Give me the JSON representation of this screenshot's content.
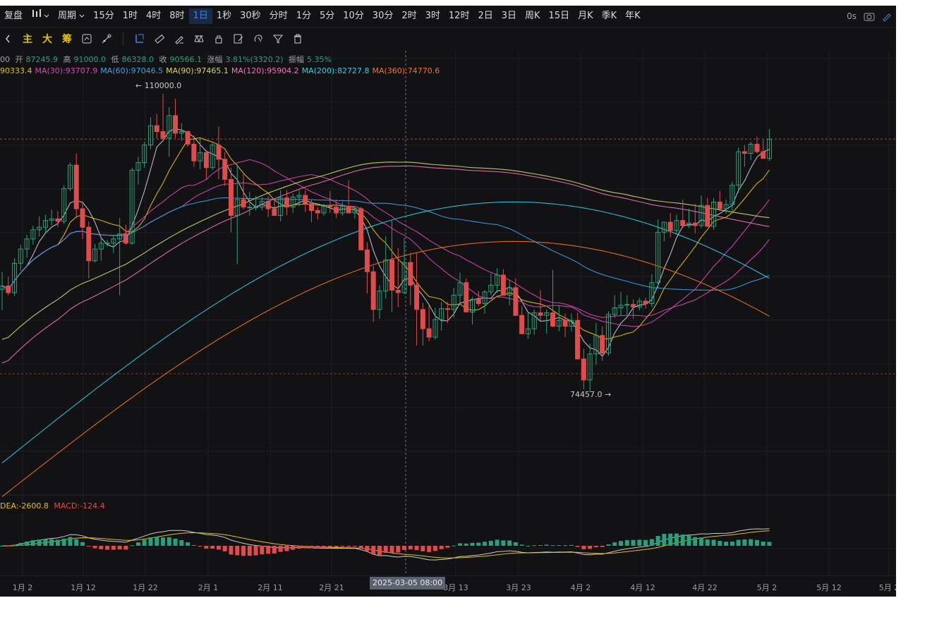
{
  "toolbar": {
    "items": [
      {
        "label": "复盘",
        "icon": "replay-icon"
      },
      {
        "label": "",
        "icon": "candle-type-icon"
      },
      {
        "label": "周期",
        "icon": "chevron-down-icon"
      },
      {
        "label": "15分"
      },
      {
        "label": "1时"
      },
      {
        "label": "4时"
      },
      {
        "label": "8时"
      },
      {
        "label": "1日",
        "active": true
      },
      {
        "label": "1秒"
      },
      {
        "label": "30秒"
      },
      {
        "label": "分时"
      },
      {
        "label": "1分"
      },
      {
        "label": "5分"
      },
      {
        "label": "10分"
      },
      {
        "label": "30分"
      },
      {
        "label": "2时"
      },
      {
        "label": "3时"
      },
      {
        "label": "12时"
      },
      {
        "label": "2日"
      },
      {
        "label": "3日"
      },
      {
        "label": "周K"
      },
      {
        "label": "15日"
      },
      {
        "label": "月K"
      },
      {
        "label": "季K"
      },
      {
        "label": "年K"
      }
    ],
    "right": {
      "time_label": "0s"
    }
  },
  "tools": {
    "text_items": [
      "主",
      "大",
      "筹"
    ]
  },
  "ohlc": {
    "prefix": "00",
    "open_label": "开",
    "open": "87245.9",
    "high_label": "高",
    "high": "91000.0",
    "low_label": "低",
    "low": "86328.0",
    "close_label": "收",
    "close": "90566.1",
    "change_label": "涨幅",
    "change": "3.81%(3320.2)",
    "amplitude_label": "振幅",
    "amplitude": "5.35%"
  },
  "ma_legend": [
    {
      "text": "90333.4",
      "color": "#e5c100"
    },
    {
      "text": "MA(30):93707.9",
      "color": "#d946b8"
    },
    {
      "text": "MA(60):97046.5",
      "color": "#3aa0e8"
    },
    {
      "text": "MA(90):97465.1",
      "color": "#d4d66a"
    },
    {
      "text": "MA(120):95904.2",
      "color": "#f472b6"
    },
    {
      "text": "MA(200):82727.8",
      "color": "#22d3ee"
    },
    {
      "text": "MA(360):74770.6",
      "color": "#f97316"
    }
  ],
  "price_marks": {
    "high": "← 110000.0",
    "low": "74457.0 →"
  },
  "macd_legend": {
    "dea": "DEA:-2600.8",
    "macd": "MACD:-124.4"
  },
  "x_axis": {
    "labels": [
      "1月 2",
      "1月 12",
      "1月 22",
      "2月 1",
      "2月 11",
      "2月 21",
      "3月 13",
      "3月 23",
      "4月 2",
      "4月 12",
      "4月 22",
      "5月 2",
      "5月 12",
      "5月 2"
    ],
    "crosshair_label": "2025-03-05 08:00"
  },
  "colors": {
    "up": "#26a17b",
    "down": "#e04b4b",
    "background": "#121214"
  },
  "chart_data": {
    "type": "candlestick",
    "ohlc": [
      [
        86700,
        88800,
        84200,
        87100
      ],
      [
        87100,
        88200,
        86000,
        86300
      ],
      [
        86300,
        90400,
        85900,
        89800
      ],
      [
        89800,
        92000,
        88900,
        91500
      ],
      [
        91500,
        93200,
        90500,
        92700
      ],
      [
        92700,
        94300,
        92000,
        93800
      ],
      [
        93800,
        95400,
        93000,
        94100
      ],
      [
        94100,
        95600,
        93400,
        94900
      ],
      [
        94900,
        96200,
        94300,
        95100
      ],
      [
        95100,
        96000,
        94100,
        94800
      ],
      [
        94800,
        99100,
        94500,
        98700
      ],
      [
        98700,
        101800,
        98400,
        101500
      ],
      [
        101500,
        102900,
        95200,
        96300
      ],
      [
        96300,
        97200,
        92700,
        94100
      ],
      [
        94100,
        94800,
        88000,
        90100
      ],
      [
        90100,
        92100,
        89900,
        91500
      ],
      [
        91500,
        92800,
        90100,
        92200
      ],
      [
        92200,
        92600,
        91800,
        92200
      ],
      [
        92200,
        93100,
        91000,
        92700
      ],
      [
        92700,
        95200,
        86000,
        93300
      ],
      [
        93300,
        94400,
        92000,
        92200
      ],
      [
        92200,
        101200,
        92000,
        100900
      ],
      [
        100900,
        102500,
        99200,
        101800
      ],
      [
        101800,
        104300,
        101200,
        103900
      ],
      [
        103900,
        107200,
        103400,
        106200
      ],
      [
        106200,
        107600,
        104700,
        105500
      ],
      [
        105500,
        110000,
        104800,
        104700
      ],
      [
        104700,
        108400,
        102500,
        107400
      ],
      [
        107400,
        109400,
        104700,
        105300
      ],
      [
        105300,
        106500,
        104400,
        105500
      ],
      [
        105500,
        105600,
        103700,
        104000
      ],
      [
        104000,
        105000,
        101300,
        102000
      ],
      [
        102000,
        104600,
        101000,
        103000
      ],
      [
        103000,
        103300,
        99800,
        101200
      ],
      [
        101200,
        104300,
        100900,
        103900
      ],
      [
        103900,
        106100,
        99800,
        102200
      ],
      [
        102200,
        103100,
        99000,
        99800
      ],
      [
        99800,
        101200,
        93500,
        95500
      ],
      [
        95500,
        101600,
        89700,
        97400
      ],
      [
        97400,
        100400,
        96200,
        96500
      ],
      [
        96500,
        98300,
        95500,
        96500
      ],
      [
        96500,
        97800,
        96100,
        96500
      ],
      [
        96500,
        97700,
        96100,
        97200
      ],
      [
        97200,
        97800,
        95300,
        96300
      ],
      [
        96300,
        97600,
        95900,
        95500
      ],
      [
        95500,
        98500,
        94800,
        97600
      ],
      [
        97600,
        98500,
        95500,
        96500
      ],
      [
        96500,
        98100,
        95800,
        97700
      ],
      [
        97700,
        98500,
        96600,
        97900
      ],
      [
        97900,
        98500,
        95900,
        96900
      ],
      [
        96900,
        97300,
        94700,
        96100
      ],
      [
        96100,
        96500,
        95000,
        95800
      ],
      [
        95800,
        96900,
        95500,
        96600
      ],
      [
        96600,
        98400,
        95800,
        96500
      ],
      [
        96500,
        97400,
        95200,
        95800
      ],
      [
        95800,
        97100,
        95500,
        96600
      ],
      [
        96600,
        99700,
        95900,
        95800
      ],
      [
        95800,
        96500,
        95100,
        96300
      ],
      [
        96300,
        96500,
        91800,
        91400
      ],
      [
        91400,
        92300,
        86200,
        88800
      ],
      [
        88800,
        89500,
        82800,
        84300
      ],
      [
        84300,
        87200,
        83200,
        86500
      ],
      [
        86500,
        93000,
        85600,
        90200
      ],
      [
        90200,
        95000,
        84000,
        86600
      ],
      [
        86600,
        91600,
        84600,
        86300
      ],
      [
        86300,
        92800,
        86100,
        89900
      ],
      [
        89900,
        91100,
        84800,
        87200
      ],
      [
        87200,
        91000,
        80000,
        84300
      ],
      [
        84300,
        85100,
        80000,
        82000
      ],
      [
        82000,
        84800,
        80500,
        81000
      ],
      [
        81000,
        84500,
        80700,
        83100
      ],
      [
        83100,
        85200,
        81800,
        84400
      ],
      [
        84400,
        85200,
        82700,
        84300
      ],
      [
        84300,
        86900,
        83300,
        86000
      ],
      [
        86000,
        88700,
        85100,
        87500
      ],
      [
        87500,
        88000,
        84900,
        84000
      ],
      [
        84000,
        85800,
        82500,
        85500
      ],
      [
        85500,
        86500,
        84700,
        85000
      ],
      [
        85000,
        86600,
        83800,
        86400
      ],
      [
        86400,
        88600,
        86000,
        87200
      ],
      [
        87200,
        89200,
        86300,
        88400
      ],
      [
        88400,
        89100,
        86500,
        86000
      ],
      [
        86000,
        87800,
        84800,
        86900
      ],
      [
        86900,
        88000,
        83500,
        83600
      ],
      [
        83600,
        84700,
        81900,
        81400
      ],
      [
        81400,
        84000,
        80800,
        82000
      ],
      [
        82000,
        84300,
        81300,
        83900
      ],
      [
        83900,
        86600,
        83000,
        83600
      ],
      [
        83600,
        84300,
        81400,
        83900
      ],
      [
        83900,
        89000,
        82200,
        82300
      ],
      [
        82300,
        84800,
        81700,
        83000
      ],
      [
        83000,
        83800,
        81000,
        82300
      ],
      [
        82300,
        83800,
        81700,
        83000
      ],
      [
        83000,
        83900,
        81700,
        78400
      ],
      [
        78400,
        79600,
        74800,
        75900
      ],
      [
        75900,
        80200,
        74457,
        79000
      ],
      [
        79000,
        82700,
        77700,
        81200
      ],
      [
        81200,
        82300,
        78200,
        79100
      ],
      [
        79100,
        84100,
        78800,
        83700
      ],
      [
        83700,
        86000,
        83300,
        84500
      ],
      [
        84500,
        86400,
        83500,
        84800
      ],
      [
        84800,
        86000,
        83700,
        84900
      ],
      [
        84900,
        85500,
        83200,
        84600
      ],
      [
        84600,
        85700,
        84200,
        85300
      ],
      [
        85300,
        85700,
        84400,
        85000
      ],
      [
        85000,
        88500,
        84600,
        87500
      ],
      [
        87500,
        95000,
        86900,
        93500
      ],
      [
        93500,
        94700,
        92400,
        94700
      ],
      [
        94700,
        95800,
        92900,
        93700
      ],
      [
        93700,
        95600,
        93300,
        94900
      ],
      [
        94900,
        97400,
        94000,
        94300
      ],
      [
        94300,
        96300,
        94000,
        94600
      ],
      [
        94600,
        96900,
        93400,
        94300
      ],
      [
        94300,
        97900,
        94000,
        96700
      ],
      [
        96700,
        97600,
        95900,
        94200
      ],
      [
        94200,
        97600,
        93800,
        97100
      ],
      [
        97100,
        98400,
        96000,
        96300
      ],
      [
        96300,
        97400,
        95700,
        96800
      ],
      [
        96800,
        99500,
        95800,
        99100
      ],
      [
        99100,
        103600,
        98200,
        103100
      ],
      [
        103100,
        103900,
        101300,
        102900
      ],
      [
        102900,
        104300,
        102100,
        104000
      ],
      [
        104000,
        104900,
        102900,
        103100
      ],
      [
        103100,
        104500,
        102500,
        102300
      ],
      [
        102300,
        105800,
        102000,
        104600
      ]
    ],
    "high_mark": 110000,
    "low_mark": 74457,
    "ma_periods": [
      5,
      10,
      20,
      30,
      60,
      90,
      120,
      200,
      360
    ]
  }
}
